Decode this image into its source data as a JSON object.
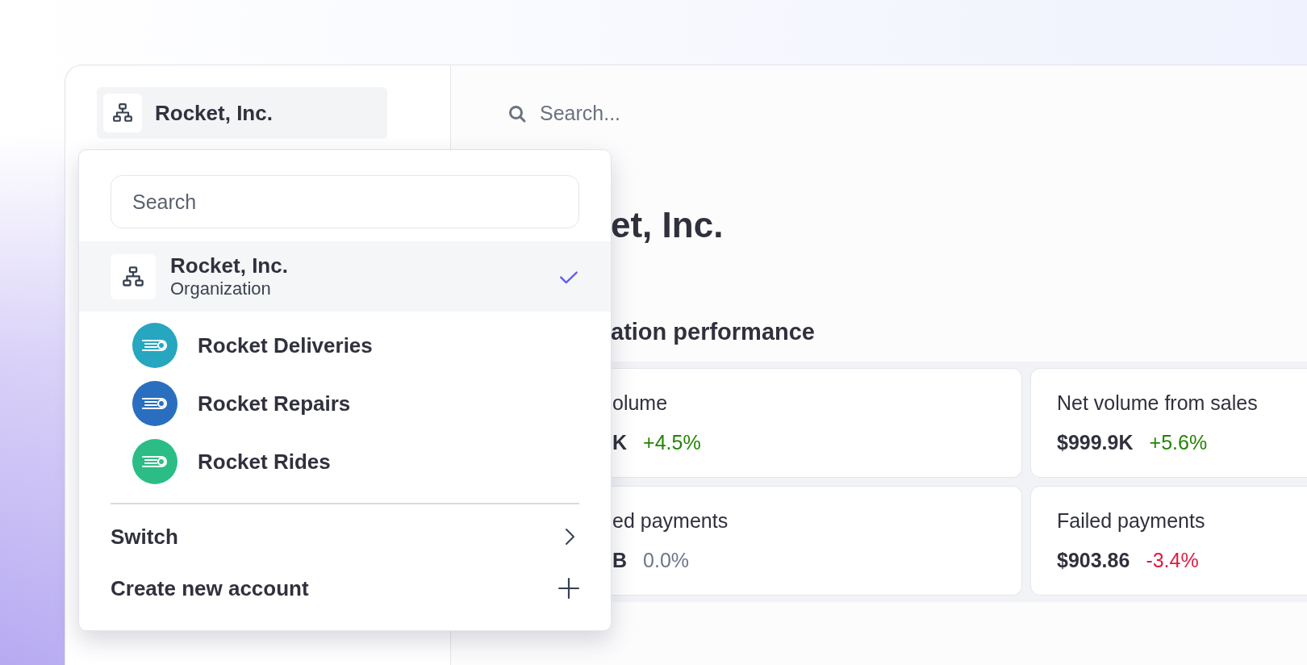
{
  "sidebar": {
    "account_button": {
      "label": "Rocket, Inc."
    }
  },
  "topbar": {
    "search": {
      "placeholder": "Search..."
    }
  },
  "main": {
    "title": "et, Inc.",
    "section_title": "ation performance",
    "cards": [
      {
        "label": "olume",
        "value": "K",
        "change": "+4.5%",
        "color": "#228403"
      },
      {
        "label": "Net volume from sales",
        "value": "$999.9K",
        "change": "+5.6%",
        "color": "#228403"
      },
      {
        "label": "ed payments",
        "value": "B",
        "change": "0.0%",
        "color": "#6c7688"
      },
      {
        "label": "Failed payments",
        "value": "$903.86",
        "change": "-3.4%",
        "color": "#df1b41"
      }
    ]
  },
  "dropdown": {
    "search": {
      "placeholder": "Search"
    },
    "items": [
      {
        "kind": "organization",
        "name": "Rocket, Inc.",
        "subtitle": "Organization",
        "selected": true
      },
      {
        "kind": "account",
        "name": "Rocket Deliveries",
        "color": "#26a6bf",
        "selected": false
      },
      {
        "kind": "account",
        "name": "Rocket Repairs",
        "color": "#2a6fbf",
        "selected": false
      },
      {
        "kind": "account",
        "name": "Rocket Rides",
        "color": "#2bbd85",
        "selected": false
      }
    ],
    "actions": [
      {
        "kind": "submenu",
        "label": "Switch"
      },
      {
        "kind": "create",
        "label": "Create new account"
      }
    ]
  }
}
